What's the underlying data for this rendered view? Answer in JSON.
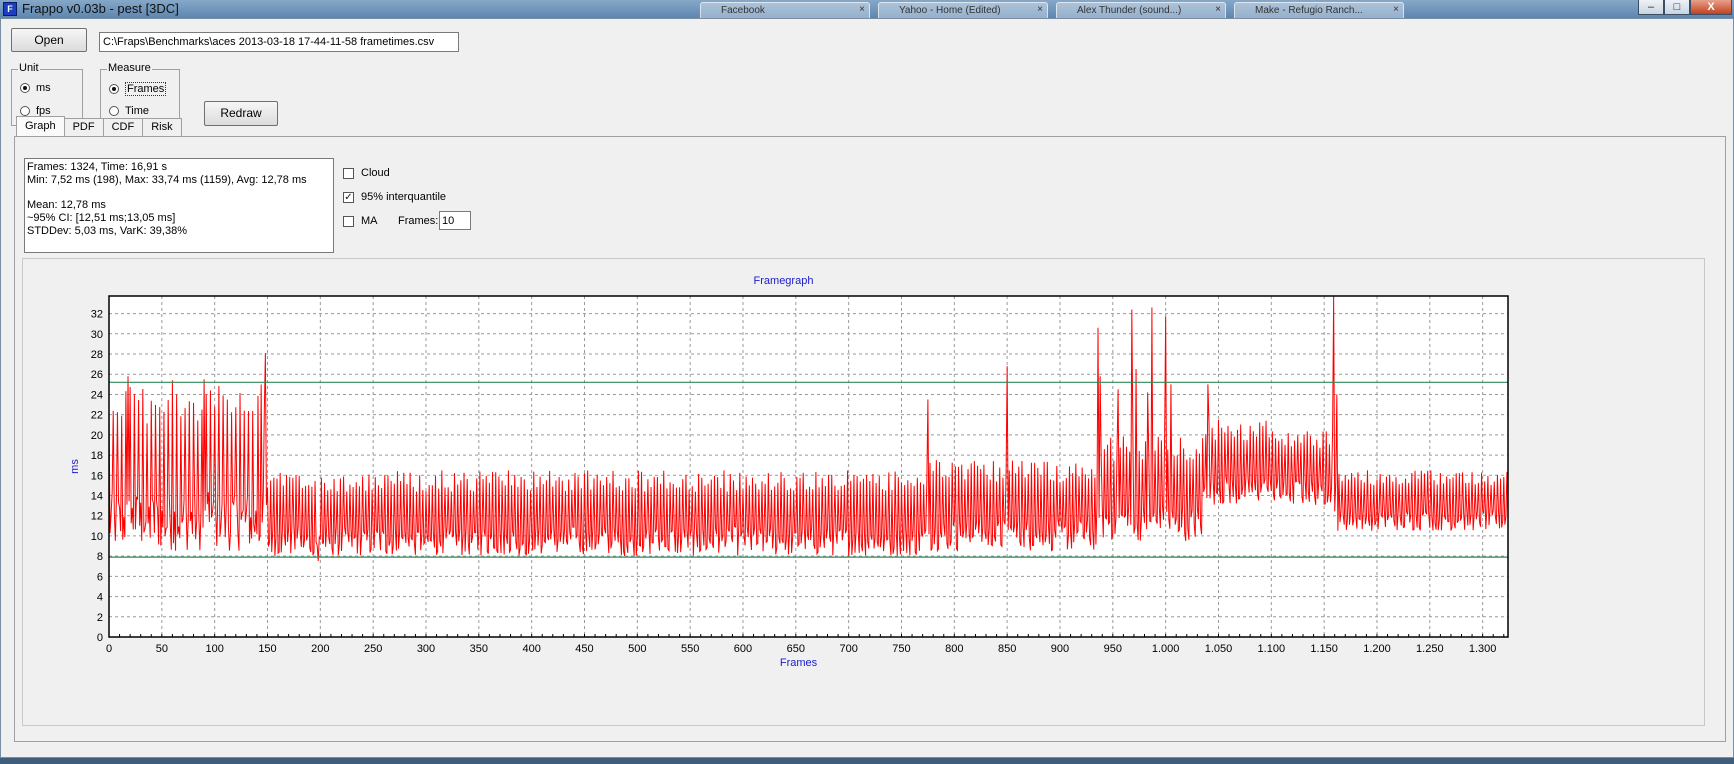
{
  "window": {
    "title": "Frappo v0.03b - pest [3DC]",
    "background_tabs": [
      "Facebook",
      "Yahoo - Home (Edited)",
      "Alex Thunder (sound...)",
      "Make - Refugio Ranch..."
    ],
    "controls": {
      "minimize": "–",
      "maximize": "□",
      "close": "X"
    }
  },
  "toolbar": {
    "open_label": "Open",
    "file_path": "C:\\Fraps\\Benchmarks\\aces 2013-03-18 17-44-11-58 frametimes.csv",
    "redraw_label": "Redraw"
  },
  "unit_group": {
    "label": "Unit",
    "options": [
      {
        "label": "ms",
        "selected": true
      },
      {
        "label": "fps",
        "selected": false
      }
    ]
  },
  "measure_group": {
    "label": "Measure",
    "options": [
      {
        "label": "Frames",
        "selected": true
      },
      {
        "label": "Time",
        "selected": false
      }
    ]
  },
  "tabs": [
    "Graph",
    "PDF",
    "CDF",
    "Risk"
  ],
  "active_tab": "Graph",
  "stats": {
    "line1": "Frames: 1324, Time: 16,91 s",
    "line2": "Min: 7,52 ms (198), Max: 33,74 ms (1159), Avg: 12,78 ms",
    "line3": "Mean: 12,78 ms",
    "line4": "~95% CI: [12,51 ms;13,05 ms]",
    "line5": "STDDev: 5,03 ms, VarK: 39,38%"
  },
  "options": {
    "cloud": {
      "label": "Cloud",
      "checked": false
    },
    "interquantile": {
      "label": "95% interquantile",
      "checked": true
    },
    "ma": {
      "label": "MA",
      "checked": false
    },
    "frames_label": "Frames:",
    "frames_value": "10"
  },
  "chart_data": {
    "type": "line",
    "title": "Framegraph",
    "xlabel": "Frames",
    "ylabel": "ms",
    "xlim": [
      0,
      1324
    ],
    "ylim": [
      0,
      33.74
    ],
    "x_ticks": [
      0,
      50,
      100,
      150,
      200,
      250,
      300,
      350,
      400,
      450,
      500,
      550,
      600,
      650,
      700,
      750,
      800,
      850,
      900,
      950,
      1000,
      1050,
      1100,
      1150,
      1200,
      1250,
      1300
    ],
    "x_tick_labels": [
      "0",
      "50",
      "100",
      "150",
      "200",
      "250",
      "300",
      "350",
      "400",
      "450",
      "500",
      "550",
      "600",
      "650",
      "700",
      "750",
      "800",
      "850",
      "900",
      "950",
      "1.000",
      "1.050",
      "1.100",
      "1.150",
      "1.200",
      "1.250",
      "1.300"
    ],
    "y_ticks": [
      0,
      2,
      4,
      6,
      8,
      10,
      12,
      14,
      16,
      18,
      20,
      22,
      24,
      26,
      28,
      30,
      32
    ],
    "grid": true,
    "line_color": "#ff0000",
    "interquantile_color": "#2e8b57",
    "interquantile_lines": [
      25.2,
      7.9
    ],
    "segments": [
      {
        "x": [
          0,
          140
        ],
        "low": 8.5,
        "high": 25.2,
        "period": 4
      },
      {
        "x": [
          140,
          150
        ],
        "low": 8,
        "high": 25.5,
        "period": 3
      },
      {
        "x": [
          150,
          775
        ],
        "low": 8.0,
        "high": 16.5,
        "period": 3
      },
      {
        "x": [
          775,
          935
        ],
        "low": 8.5,
        "high": 17.5,
        "period": 3
      },
      {
        "x": [
          935,
          1035
        ],
        "low": 9.5,
        "high": 20,
        "period": 3
      },
      {
        "x": [
          1035,
          1100
        ],
        "low": 13.0,
        "high": 21.5,
        "period": 3
      },
      {
        "x": [
          1100,
          1160
        ],
        "low": 13.0,
        "high": 20.5,
        "period": 3
      },
      {
        "x": [
          1160,
          1324
        ],
        "low": 10.5,
        "high": 16.5,
        "period": 3
      }
    ],
    "spikes": [
      {
        "x": 18,
        "y": 25.8
      },
      {
        "x": 60,
        "y": 25.4
      },
      {
        "x": 90,
        "y": 25.5
      },
      {
        "x": 148,
        "y": 28.1
      },
      {
        "x": 775,
        "y": 23.5
      },
      {
        "x": 850,
        "y": 26.8
      },
      {
        "x": 936,
        "y": 30.6
      },
      {
        "x": 938,
        "y": 25.8
      },
      {
        "x": 955,
        "y": 24.5
      },
      {
        "x": 968,
        "y": 32.4
      },
      {
        "x": 972,
        "y": 26.5
      },
      {
        "x": 983,
        "y": 24.2
      },
      {
        "x": 987,
        "y": 32.6
      },
      {
        "x": 1000,
        "y": 31.7
      },
      {
        "x": 1005,
        "y": 25.0
      },
      {
        "x": 1159,
        "y": 33.74
      },
      {
        "x": 1162,
        "y": 24.0
      },
      {
        "x": 1040,
        "y": 25.0
      }
    ],
    "min_point": {
      "x": 198,
      "y": 7.52
    }
  }
}
